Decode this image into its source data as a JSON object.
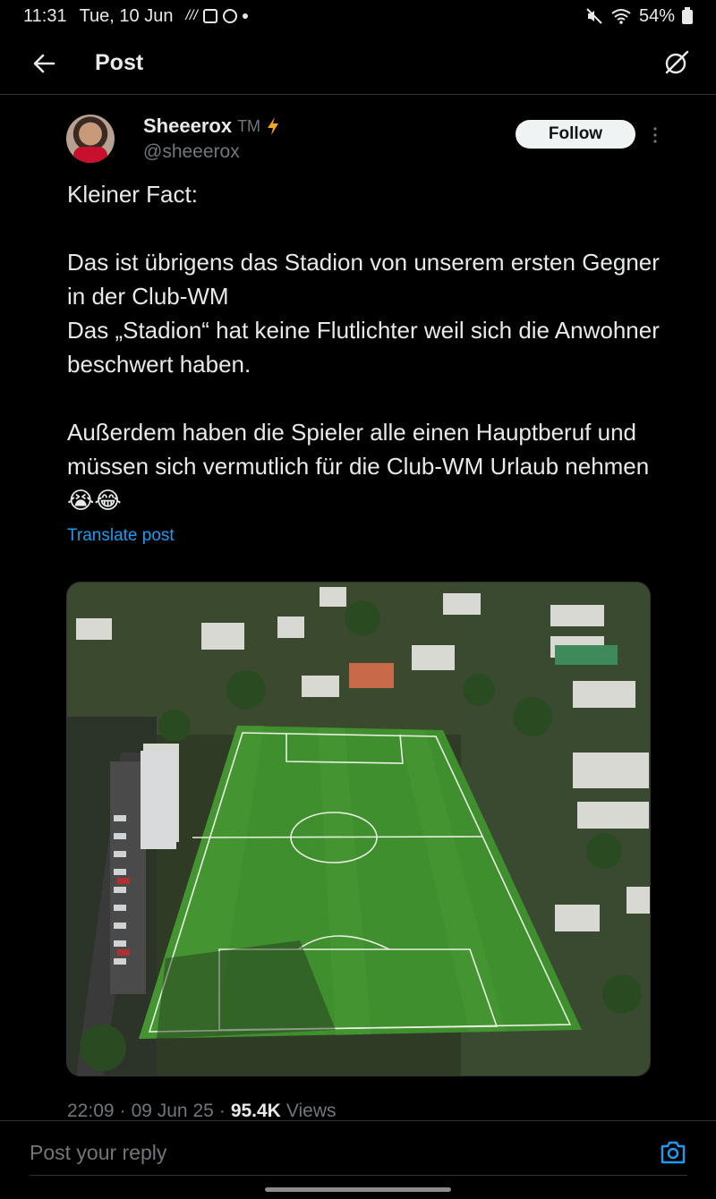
{
  "status_bar": {
    "time": "11:31",
    "date": "Tue, 10 Jun",
    "battery": "54%"
  },
  "header": {
    "title": "Post"
  },
  "post": {
    "author": {
      "display_name": "Sheeerox",
      "badge": "TM",
      "handle": "@sheeerox"
    },
    "follow_label": "Follow",
    "text": "Kleiner Fact:\n\nDas ist übrigens das Stadion von unserem ersten Gegner in der Club-WM\nDas „Stadion“ hat keine Flutlichter weil sich die Anwohner beschwert haben.\n\nAußerdem haben die Spieler alle einen Hauptberuf und müssen sich vermutlich für die Club-WM Urlaub nehmen 😭😂",
    "translate_label": "Translate post",
    "time": "22:09",
    "date": "09 Jun 25",
    "views_count": "95.4K",
    "views_label": "Views"
  },
  "reply": {
    "placeholder": "Post your reply"
  },
  "colors": {
    "background": "#000000",
    "text": "#e7e9ea",
    "secondary_text": "#71767b",
    "accent": "#1d9bf0",
    "pitch_green": "#3f8f2f"
  },
  "icons": {
    "back": "arrow-left-icon",
    "grok": "grok-icon",
    "verified": "lightning-bolt-icon",
    "more": "more-vertical-icon",
    "camera": "camera-icon"
  }
}
